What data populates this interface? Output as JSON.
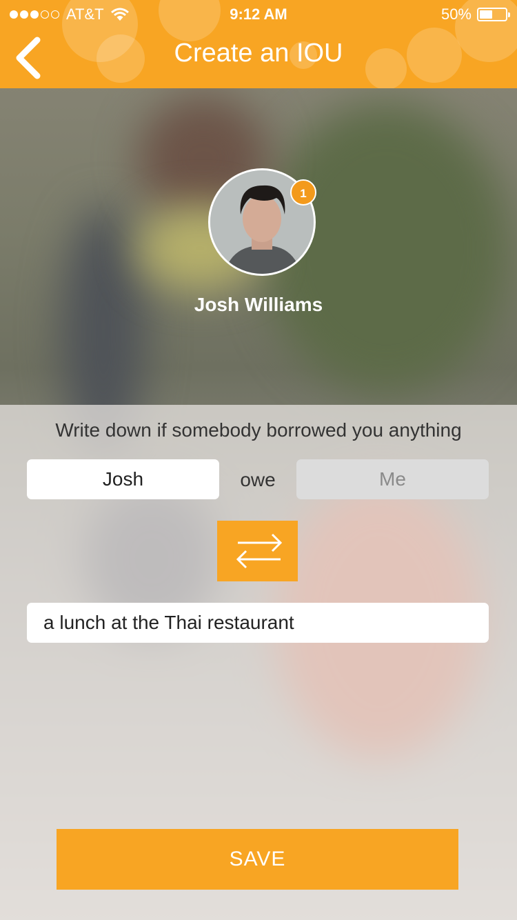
{
  "status_bar": {
    "carrier": "AT&T",
    "time": "9:12 AM",
    "battery": "50%",
    "battery_level": 0.5,
    "signal_bars_filled": 3,
    "signal_bars_total": 5
  },
  "header": {
    "title": "Create an IOU",
    "back_icon": "chevron-left-icon"
  },
  "profile": {
    "name": "Josh Williams",
    "badge_count": "1"
  },
  "form": {
    "hint": "Write down if somebody borrowed you anything",
    "debtor": "Josh",
    "verb": "owe",
    "creditor": "Me",
    "swap_icon": "swap-arrows-icon",
    "description": "a lunch at the Thai restaurant",
    "save_label": "SAVE"
  },
  "colors": {
    "accent": "#f8a523",
    "badge": "#f39a1c",
    "inactive_field": "#dcdcdc"
  }
}
